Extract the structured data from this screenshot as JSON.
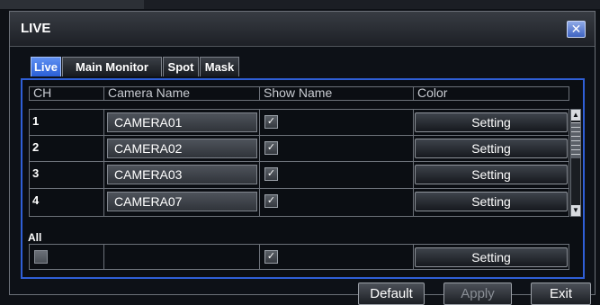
{
  "window": {
    "title": "LIVE",
    "close_symbol": "✕"
  },
  "tabs": [
    {
      "label": "Live",
      "active": true
    },
    {
      "label": "Main Monitor",
      "active": false
    },
    {
      "label": "Spot",
      "active": false
    },
    {
      "label": "Mask",
      "active": false
    }
  ],
  "table": {
    "headers": {
      "ch": "CH",
      "camera_name": "Camera Name",
      "show_name": "Show Name",
      "color": "Color"
    },
    "rows": [
      {
        "ch": "1",
        "camera_name": "CAMERA01",
        "show_name": true,
        "color_button": "Setting"
      },
      {
        "ch": "2",
        "camera_name": "CAMERA02",
        "show_name": true,
        "color_button": "Setting"
      },
      {
        "ch": "3",
        "camera_name": "CAMERA03",
        "show_name": true,
        "color_button": "Setting"
      },
      {
        "ch": "4",
        "camera_name": "CAMERA07",
        "show_name": true,
        "color_button": "Setting"
      }
    ]
  },
  "all_row": {
    "label": "All",
    "ch_checked": false,
    "show_name": true,
    "color_button": "Setting"
  },
  "check_glyph": "✓",
  "buttons": {
    "default": "Default",
    "apply": "Apply",
    "exit": "Exit"
  },
  "colors": {
    "accent": "#2f5fd7",
    "active_tab": "#3d74e6",
    "background": "#0d1117"
  }
}
